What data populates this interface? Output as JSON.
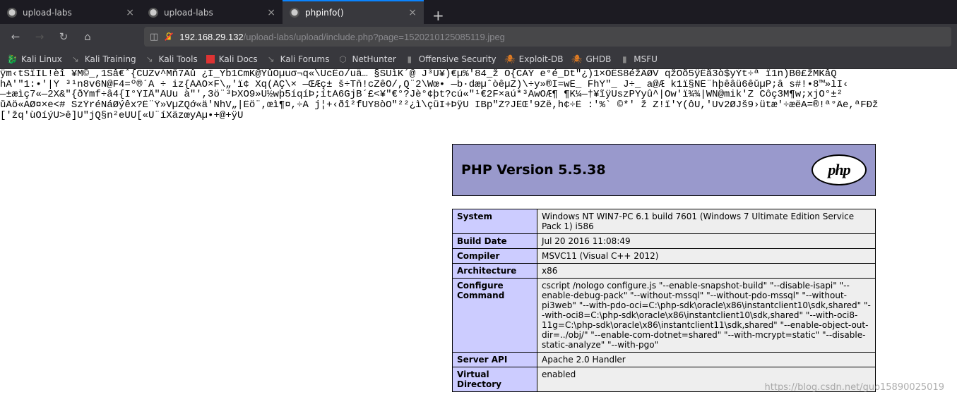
{
  "tabs": [
    {
      "title": "upload-labs",
      "fav": "blank"
    },
    {
      "title": "upload-labs",
      "fav": "blank"
    },
    {
      "title": "phpinfo()",
      "fav": "blank"
    }
  ],
  "url": {
    "host": "192.168.29.132",
    "path": "/upload-labs/upload/include.php?page=1520210125085119.jpeg"
  },
  "bookmarks": [
    {
      "label": "Kali Linux",
      "icon": "dragon"
    },
    {
      "label": "Kali Training",
      "icon": "gray"
    },
    {
      "label": "Kali Tools",
      "icon": "gray"
    },
    {
      "label": "Kali Docs",
      "icon": "red"
    },
    {
      "label": "Kali Forums",
      "icon": "gray"
    },
    {
      "label": "NetHunter",
      "icon": "gray"
    },
    {
      "label": "Offensive Security",
      "icon": "d"
    },
    {
      "label": "Exploit-DB",
      "icon": "orange"
    },
    {
      "label": "GHDB",
      "icon": "orange"
    },
    {
      "label": "MSFU",
      "icon": "d"
    }
  ],
  "garbage": [
    "ÿm‹tŠïIL!èî  ¥M©_,1Sâ€ˆ{CÚZv^Mň7Âû ¿I_Yb1CmK@ŶûOµuσ¬q«\\ÙcËo/uä… §ŠÜìK´@ J³Ú¥)€µ%'84_ž Ő{CÁÝ e°é_Dt\"¿)1×ÕËŠ8éžÂØV qžOõ5ÿËã3ò$yÝt÷ª ï1n)B0£žMKâQ",
    "hÁ'\"1:•'|Ÿ ³¹n8v6N@F4=º®´Á  ÷ iz{ÁÂÕ×F\\„'ï¢ Xq(ÂÇ\\× —ŒÆç±  š÷Tň!cZêÔ/,Q¨2\\Wœ• —b·dæµˆòêµZ)\\÷y»®Í=wÊ_ FhŸ\"_ J÷_ a@Æ k1ï§NË¨hþêâü6êǔµP;â s#!•8™»ĺÍ‹",
    "—±æìç7«—2X&\"{ðŸmf÷â4{I°ŸÍÅ\"ÂÚu à\"',3ö¨³ÞXÖ9»Ú½wþ5íqíÞ;ítÁ6GjB´£<¥\"€°?Jè°¢þt?cú«\"¹€2F×aú*³ÂwÔÆ¶ ¶K¼—†¥ĩÿÜszPYyû^|Õw'ï¾¾|WN@mik'Z Côç3M¶w;xjÕ°±²",
    "ǔÄö«ÀØ¤×e<# SzŸréÑáØýêx?Ë¨Ÿ»VµŽQớ«ä'ÑhV„|Ëö¨,œì¶¤,÷Á  j¦+‹ðî²fÜY8òÔ\"²²¿ì\\çüI+ÞÿÚ IBp\"Ž?ĴËŒ'9Žë,h¢÷Ë :'%` ©*' ž Z!ï'Y(ôÛ,'Úv2ØJš9›ütæ'÷æëA=®!ª°Âe,ªFĐž",
    "['žq'ùÔíýÚ>ê]Ú\"jQ§n²eÙÛ[«Ú¨íXäzœyÁµ•+@+ÿÚ"
  ],
  "php": {
    "version_label": "PHP Version 5.5.38",
    "logo_text": "php",
    "rows": [
      {
        "k": "System",
        "v": "Windows NT WIN7-PC 6.1 build 7601 (Windows 7 Ultimate Edition Service Pack 1) i586"
      },
      {
        "k": "Build Date",
        "v": "Jul 20 2016 11:08:49"
      },
      {
        "k": "Compiler",
        "v": "MSVC11 (Visual C++ 2012)"
      },
      {
        "k": "Architecture",
        "v": "x86"
      },
      {
        "k": "Configure Command",
        "v": "cscript /nologo configure.js \"--enable-snapshot-build\" \"--disable-isapi\" \"--enable-debug-pack\" \"--without-mssql\" \"--without-pdo-mssql\" \"--without-pi3web\" \"--with-pdo-oci=C:\\php-sdk\\oracle\\x86\\instantclient10\\sdk,shared\" \"--with-oci8=C:\\php-sdk\\oracle\\x86\\instantclient10\\sdk,shared\" \"--with-oci8-11g=C:\\php-sdk\\oracle\\x86\\instantclient11\\sdk,shared\" \"--enable-object-out-dir=../obj/\" \"--enable-com-dotnet=shared\" \"--with-mcrypt=static\" \"--disable-static-analyze\" \"--with-pgo\""
      },
      {
        "k": "Server API",
        "v": "Apache 2.0 Handler"
      },
      {
        "k": "Virtual Directory",
        "v": "enabled"
      }
    ]
  },
  "watermark": "https://blog.csdn.net/guo15890025019"
}
